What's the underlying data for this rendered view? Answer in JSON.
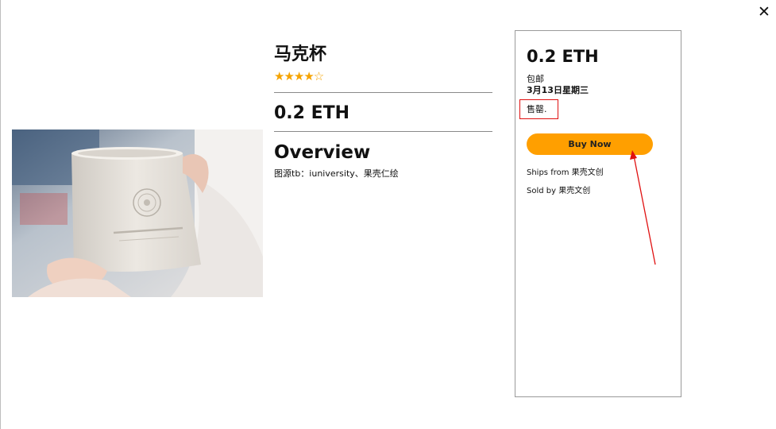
{
  "modal": {
    "close_glyph": "✕"
  },
  "product": {
    "title": "马克杯",
    "rating": {
      "value": 4,
      "max": 5,
      "stars": "★★★★☆"
    },
    "price": "0.2 ETH",
    "overview_heading": "Overview",
    "source_text": "图源tb：iuniversity、果壳仁绘",
    "image_icon": "white-ceramic-mug-photo"
  },
  "buybox": {
    "price": "0.2 ETH",
    "shipping": "包邮",
    "delivery_date": "3月13日星期三",
    "stock_status": "售罄.",
    "buy_button_label": "Buy Now",
    "ships_from_label": "Ships from",
    "ships_from_value": "果壳文创",
    "sold_by_label": "Sold by",
    "sold_by_value": "果壳文创"
  },
  "annotations": {
    "highlight_color": "#e01010"
  },
  "colors": {
    "accent": "#ff9f00",
    "star": "#f5a300"
  }
}
